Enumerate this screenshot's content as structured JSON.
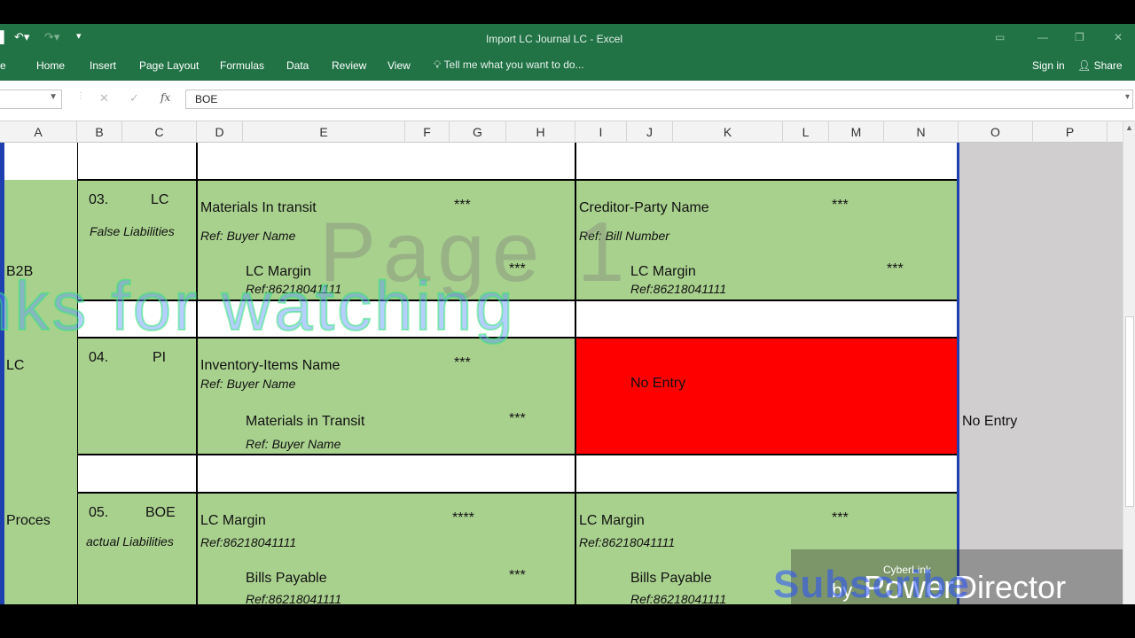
{
  "window": {
    "title": "Import LC Journal LC - Excel",
    "sign_in": "Sign in",
    "share": "Share"
  },
  "ribbon": {
    "tabs": [
      "Home",
      "Insert",
      "Page Layout",
      "Formulas",
      "Data",
      "Review",
      "View"
    ],
    "tell_me": "Tell me what you want to do..."
  },
  "formula_bar": {
    "fx": "fx",
    "value": "BOE"
  },
  "columns": [
    "A",
    "B",
    "C",
    "D",
    "E",
    "F",
    "G",
    "H",
    "I",
    "J",
    "K",
    "L",
    "M",
    "N",
    "O",
    "P"
  ],
  "rows": {
    "r03": {
      "a_label": "B2B",
      "num": "03.",
      "code": "LC",
      "desc": "False Liabilities",
      "debit_main": "Materials In transit",
      "debit_main_stars": "***",
      "debit_ref": "Ref: Buyer Name",
      "debit_sub": "LC Margin",
      "debit_sub_stars": "***",
      "debit_sub_ref": "Ref:86218041111",
      "credit_main": "Creditor-Party Name",
      "credit_main_stars": "***",
      "credit_ref": "Ref: Bill Number",
      "credit_sub": "LC Margin",
      "credit_sub_stars": "***",
      "credit_sub_ref": "Ref:86218041111"
    },
    "r04": {
      "a_label": "LC",
      "num": "04.",
      "code": "PI",
      "debit_main": "Inventory-Items Name",
      "debit_main_stars": "***",
      "debit_ref": "Ref: Buyer Name",
      "debit_sub": "Materials in Transit",
      "debit_sub_stars": "***",
      "debit_sub_ref": "Ref: Buyer Name",
      "credit_no_entry": "No Entry",
      "o_no_entry": "No Entry"
    },
    "r05": {
      "a_label": "Proces",
      "num": "05.",
      "code": "BOE",
      "desc": "actual Liabilities",
      "debit_main": "LC Margin",
      "debit_main_stars": "****",
      "debit_ref": "Ref:86218041111",
      "debit_sub": "Bills Payable",
      "debit_sub_stars": "***",
      "debit_sub_ref": "Ref:86218041111",
      "credit_main": "LC Margin",
      "credit_main_stars": "***",
      "credit_ref": "Ref:86218041111",
      "credit_sub": "Bills Payable",
      "credit_sub_ref": "Ref:86218041111"
    }
  },
  "overlays": {
    "page_watermark": "Page 1",
    "thanks": "nks for watching",
    "subscribe": "Subscribe",
    "cyberlink": "CyberLink",
    "by": "by",
    "powerdirector": "PowerDirector"
  },
  "colors": {
    "excel_green": "#217346",
    "cell_green": "#a9d18e",
    "cell_red": "#ff0000",
    "cell_gray": "#d0cece"
  }
}
